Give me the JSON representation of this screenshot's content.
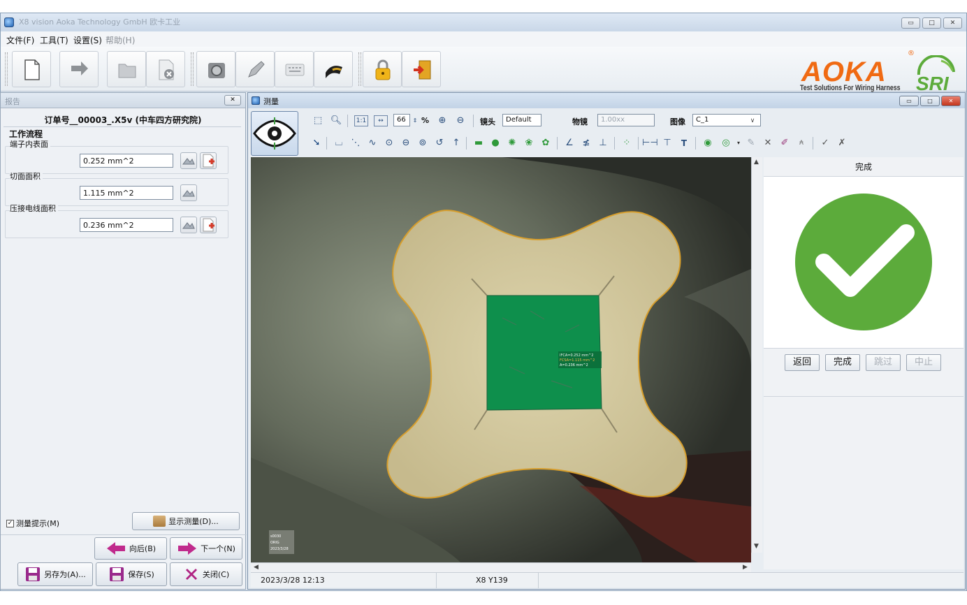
{
  "window": {
    "title": "X8 vision Aoka Technology GmbH 欧卡工业",
    "controls": [
      "minimize",
      "maximize",
      "close"
    ]
  },
  "menu": [
    "文件(F)",
    "工具(T)",
    "设置(S)",
    "帮助(H)"
  ],
  "toolbar": {
    "buttons": [
      "new-document-icon",
      "open-arrow-icon",
      "folder-icon",
      "delete-file-icon",
      "lens-icon",
      "pencil-icon",
      "keyboard-icon",
      "crimp-icon",
      "lock-icon",
      "exit-door-icon"
    ]
  },
  "brand": {
    "logo": "AOKA",
    "registered": "®",
    "tagline": "Test Solutions For Wiring Harness",
    "partner_logo": "SRI",
    "accent": "#f06a13",
    "green": "#5cab3b"
  },
  "report": {
    "panel_title": "报告",
    "close_label": "✕",
    "order_title": "订单号__00003_.X5v (中车四方研究院)",
    "workflow_label": "工作流程",
    "groups": [
      {
        "label": "端子内表面",
        "value": "0.252 mm^2"
      },
      {
        "label": "切面面积",
        "value": "1.115 mm^2"
      },
      {
        "label": "压接电线面积",
        "value": "0.236 mm^2"
      }
    ],
    "measure_hint_label": "测量提示(M)",
    "measure_hint_checked": true,
    "show_measure_label": "显示测量(D)...",
    "back_label": "向后(B)",
    "next_label": "下一个(N)",
    "save_as_label": "另存为(A)...",
    "save_label": "保存(S)",
    "close_button_label": "关闭(C)"
  },
  "measure": {
    "title": "测量",
    "zoom_value": "66",
    "zoom_unit": "%",
    "one_to_one": "1:1",
    "fit": "↔",
    "lens_label": "镜头",
    "lens_value": "Default",
    "objective_label": "物镜",
    "objective_value": "1.00xx",
    "image_label": "图像",
    "image_value": "C_1",
    "text_tool": "T",
    "overlay_lines": [
      "IFCA=0.252 mm^2",
      "FCSA=1.115 mm^2",
      "A=0.236 mm^2"
    ],
    "stamp_lines": [
      "s0030",
      "ORIG",
      "2023/3/28"
    ],
    "colors": {
      "fill_green": "#0e8f4c",
      "terminal": "#cfc59c",
      "outline": "#d79e2c"
    },
    "right_panel": {
      "header": "完成",
      "result": "pass",
      "buttons": [
        {
          "label": "返回",
          "enabled": true
        },
        {
          "label": "完成",
          "enabled": true
        },
        {
          "label": "跳过",
          "enabled": false
        },
        {
          "label": "中止",
          "enabled": false
        }
      ]
    },
    "status": {
      "datetime": "2023/3/28 12:13",
      "coords": "X8 Y139"
    }
  }
}
